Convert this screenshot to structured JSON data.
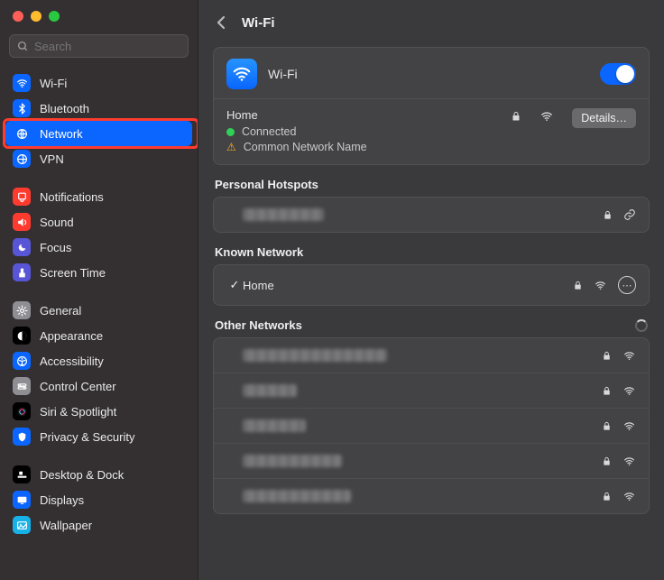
{
  "search_placeholder": "Search",
  "page_title": "Wi-Fi",
  "sidebar": {
    "group1": [
      {
        "key": "wifi",
        "label": "Wi-Fi",
        "bg": "#0a66ff"
      },
      {
        "key": "bluetooth",
        "label": "Bluetooth",
        "bg": "#0a66ff"
      },
      {
        "key": "network",
        "label": "Network",
        "bg": "#0a66ff",
        "selected": true,
        "highlight": true
      },
      {
        "key": "vpn",
        "label": "VPN",
        "bg": "#0a66ff"
      }
    ],
    "group2": [
      {
        "key": "notifications",
        "label": "Notifications",
        "bg": "#ff3b30"
      },
      {
        "key": "sound",
        "label": "Sound",
        "bg": "#ff3b30"
      },
      {
        "key": "focus",
        "label": "Focus",
        "bg": "#5856d6"
      },
      {
        "key": "screentime",
        "label": "Screen Time",
        "bg": "#5856d6"
      }
    ],
    "group3": [
      {
        "key": "general",
        "label": "General",
        "bg": "#8e8e93"
      },
      {
        "key": "appearance",
        "label": "Appearance",
        "bg": "#000000"
      },
      {
        "key": "accessibility",
        "label": "Accessibility",
        "bg": "#0a66ff"
      },
      {
        "key": "controlcenter",
        "label": "Control Center",
        "bg": "#8e8e93"
      },
      {
        "key": "siri",
        "label": "Siri & Spotlight",
        "bg": "#000000"
      },
      {
        "key": "privacy",
        "label": "Privacy & Security",
        "bg": "#0a66ff"
      }
    ],
    "group4": [
      {
        "key": "desktop",
        "label": "Desktop & Dock",
        "bg": "#000000"
      },
      {
        "key": "displays",
        "label": "Displays",
        "bg": "#0a66ff"
      },
      {
        "key": "wallpaper",
        "label": "Wallpaper",
        "bg": "#17b1e7"
      }
    ]
  },
  "wifi_card": {
    "title": "Wi-Fi",
    "network_name": "Home",
    "status": "Connected",
    "warning": "Common Network Name",
    "details_label": "Details…"
  },
  "sections": {
    "hotspots": "Personal Hotspots",
    "known": "Known Network",
    "other": "Other Networks"
  },
  "hotspots": [
    {
      "blur_width": 90
    }
  ],
  "known_networks": [
    {
      "name": "Home",
      "checked": true
    }
  ],
  "other_networks": [
    {
      "blur_width": 160
    },
    {
      "blur_width": 60
    },
    {
      "blur_width": 70
    },
    {
      "blur_width": 110
    },
    {
      "blur_width": 120
    }
  ]
}
